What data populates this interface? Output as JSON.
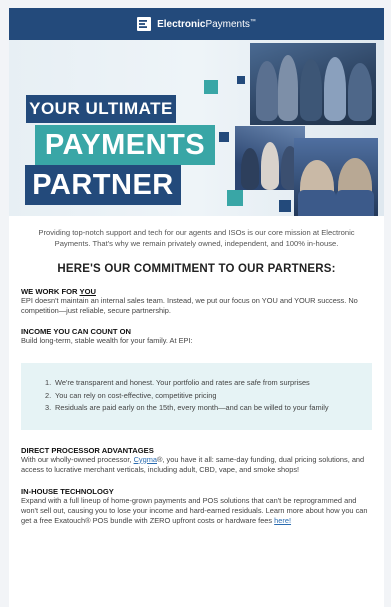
{
  "header": {
    "brand_bold": "Electronic",
    "brand_regular": "Payments",
    "brand_mark": "™"
  },
  "hero": {
    "line1": "YOUR ULTIMATE",
    "line2": "PAYMENTS",
    "line3": "PARTNER"
  },
  "intro": "Providing top-notch support and tech for our agents and ISOs is our core mission at Electronic Payments. That's why we remain privately owned, independent, and 100% in-house.",
  "commitment_heading": "HERE'S OUR COMMITMENT TO OUR PARTNERS:",
  "sections": {
    "work": {
      "title_prefix": "WE WORK FOR ",
      "title_emph": "YOU",
      "body": "EPI doesn't maintain an internal sales team. Instead, we put our focus on YOU and YOUR success. No competition—just reliable, secure partnership."
    },
    "income": {
      "title": "INCOME YOU CAN COUNT ON",
      "body": "Build long-term, stable wealth for your family. At EPI:"
    },
    "points": [
      {
        "num": "1.",
        "text": "We're transparent and honest. Your portfolio and rates are safe from surprises"
      },
      {
        "num": "2.",
        "text": "You can rely on cost-effective, competitive pricing"
      },
      {
        "num": "3.",
        "text": "Residuals are paid early on the 15th, every month—and can be willed to your family"
      }
    ],
    "direct": {
      "title": "DIRECT PROCESSOR ADVANTAGES",
      "body_pre": "With our wholly-owned processor, ",
      "link": "Cygma",
      "body_post": "®, you have it all: same-day funding, dual pricing solutions, and access to lucrative merchant verticals, including adult, CBD, vape, and smoke shops!"
    },
    "tech": {
      "title": "IN-HOUSE TECHNOLOGY",
      "body_pre": "Expand with a full lineup of home-grown payments and POS solutions that can't be reprogrammed and won't sell out, causing you to lose your income and hard-earned residuals. Learn more about how you can get a free Exatouch® POS bundle with ZERO upfront costs or hardware fees ",
      "link": "here!"
    }
  },
  "colors": {
    "navy": "#234a7b",
    "teal": "#39a6a6",
    "note_bg": "#e6f3f5",
    "link": "#2b6cb0"
  }
}
